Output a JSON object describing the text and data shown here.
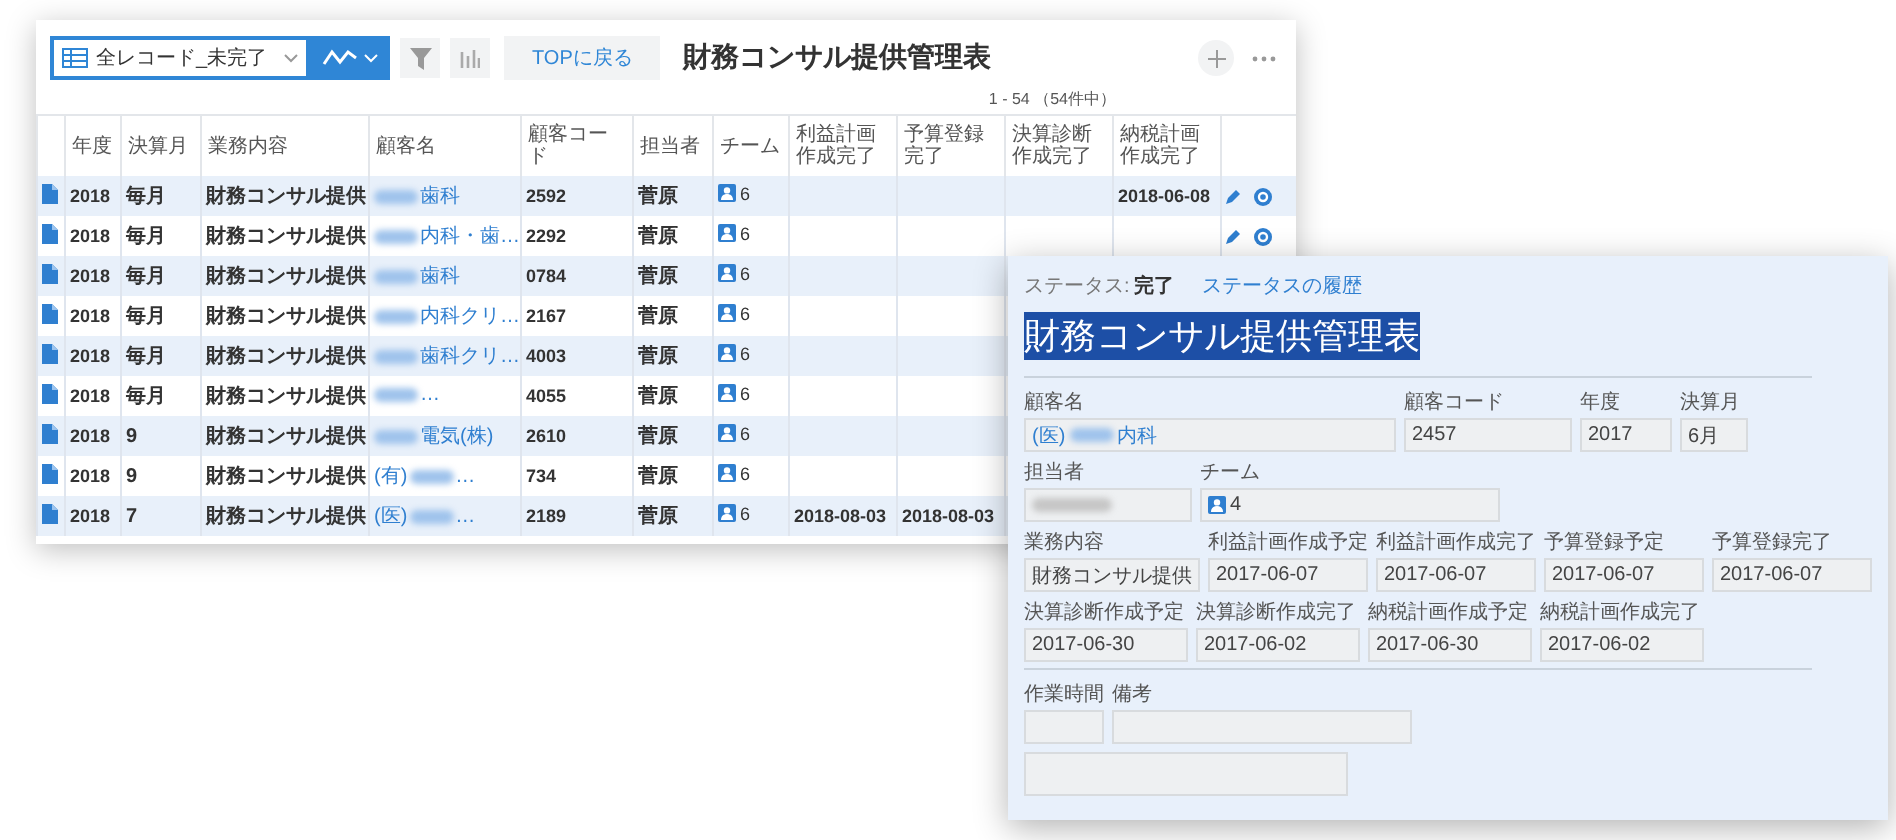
{
  "list_window": {
    "view_selector": {
      "label": "全レコード_未完了"
    },
    "back_button": "TOPに戻る",
    "title": "財務コンサル提供管理表",
    "pagination": "1 - 54 （54件中）",
    "columns": [
      "年度",
      "決算月",
      "業務内容",
      "顧客名",
      "顧客コード",
      "担当者",
      "チーム",
      "利益計画作成完了",
      "予算登録完了",
      "決算診断作成完了",
      "納税計画作成完了"
    ],
    "rows": [
      {
        "year": "2018",
        "month": "毎月",
        "service": "財務コンサル提供",
        "customer": {
          "redacted": true,
          "value": "歯科"
        },
        "code": "2592",
        "staff": "菅原",
        "team": "6",
        "tax_done": "2018-06-08",
        "tools": true
      },
      {
        "year": "2018",
        "month": "毎月",
        "service": "財務コンサル提供",
        "customer": {
          "redacted": true,
          "value": "内科・歯…"
        },
        "code": "2292",
        "staff": "菅原",
        "team": "6",
        "tools": true
      },
      {
        "year": "2018",
        "month": "毎月",
        "service": "財務コンサル提供",
        "customer": {
          "redacted": true,
          "value": "歯科"
        },
        "code": "0784",
        "staff": "菅原",
        "team": "6",
        "tools": false
      },
      {
        "year": "2018",
        "month": "毎月",
        "service": "財務コンサル提供",
        "customer": {
          "redacted": true,
          "value": "内科クリ…"
        },
        "code": "2167",
        "staff": "菅原",
        "team": "6",
        "tools": false
      },
      {
        "year": "2018",
        "month": "毎月",
        "service": "財務コンサル提供",
        "customer": {
          "redacted": true,
          "value": "歯科クリ…"
        },
        "code": "4003",
        "staff": "菅原",
        "team": "6",
        "tools": false
      },
      {
        "year": "2018",
        "month": "毎月",
        "service": "財務コンサル提供",
        "customer": {
          "redacted": true,
          "value": "…"
        },
        "code": "4055",
        "staff": "菅原",
        "team": "6",
        "tools": false
      },
      {
        "year": "2018",
        "month": "9",
        "service": "財務コンサル提供",
        "customer": {
          "redacted": true,
          "value": "電気(株)"
        },
        "code": "2610",
        "staff": "菅原",
        "team": "6",
        "tools": false
      },
      {
        "year": "2018",
        "month": "9",
        "service": "財務コンサル提供",
        "customer": {
          "lead": "(有)",
          "redacted": true,
          "value": "…"
        },
        "code": "734",
        "staff": "菅原",
        "team": "6",
        "tools": false
      },
      {
        "year": "2018",
        "month": "7",
        "service": "財務コンサル提供",
        "customer": {
          "lead": "(医)",
          "redacted": true,
          "value": "…"
        },
        "code": "2189",
        "staff": "菅原",
        "team": "6",
        "profit_done": "2018-08-03",
        "budget_done": "2018-08-03",
        "tools": false
      }
    ]
  },
  "detail_window": {
    "status": {
      "label": "ステータス:",
      "value": "完了"
    },
    "history_link": "ステータスの履歴",
    "title": {
      "text": "財務コンサル提供管理表",
      "selected": true
    },
    "field_rows": [
      [
        {
          "kind": "link",
          "label": "顧客名",
          "lead": "(医)",
          "redacted": true,
          "value": "内科"
        },
        {
          "kind": "text",
          "label": "顧客コード",
          "value": "2457"
        },
        {
          "kind": "text",
          "label": "年度",
          "value": "2017"
        },
        {
          "kind": "text",
          "label": "決算月",
          "value": "6月"
        }
      ],
      [
        {
          "kind": "text",
          "label": "担当者",
          "redacted": true
        },
        {
          "kind": "team",
          "label": "チーム",
          "value": "4"
        }
      ],
      [
        {
          "kind": "text",
          "label": "業務内容",
          "value": "財務コンサル提供"
        },
        {
          "kind": "text",
          "label": "利益計画作成予定",
          "value": "2017-06-07"
        },
        {
          "kind": "text",
          "label": "利益計画作成完了",
          "value": "2017-06-07"
        },
        {
          "kind": "text",
          "label": "予算登録予定",
          "value": "2017-06-07"
        },
        {
          "kind": "text",
          "label": "予算登録完了",
          "value": "2017-06-07"
        }
      ],
      [
        {
          "kind": "text",
          "label": "決算診断作成予定",
          "value": "2017-06-30"
        },
        {
          "kind": "text",
          "label": "決算診断作成完了",
          "value": "2017-06-02"
        },
        {
          "kind": "text",
          "label": "納税計画作成予定",
          "value": "2017-06-30"
        },
        {
          "kind": "text",
          "label": "納税計画作成完了",
          "value": "2017-06-02"
        }
      ]
    ],
    "extra_fields": [
      {
        "label": "作業時間"
      },
      {
        "label": "備考"
      }
    ],
    "footer_box": {
      "kind": "blank"
    }
  }
}
